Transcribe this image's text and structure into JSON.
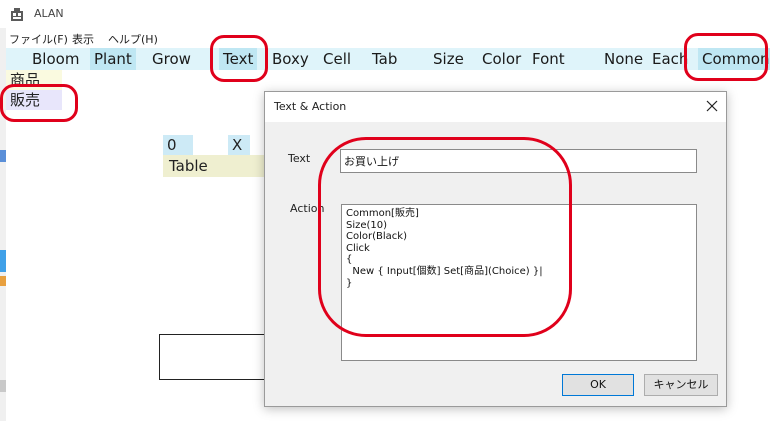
{
  "window": {
    "title": "ALAN"
  },
  "menu": [
    {
      "label": "ファイル(F)"
    },
    {
      "label": "表示"
    },
    {
      "label": "ヘルプ(H)"
    }
  ],
  "toolbar": {
    "items": [
      {
        "label": "Bloom"
      },
      {
        "label": "Plant",
        "highlighted": true
      },
      {
        "label": "Grow"
      },
      {
        "label": "Text",
        "highlighted": true,
        "annotated": true
      },
      {
        "label": "Boxy"
      },
      {
        "label": "Cell"
      },
      {
        "label": "Tab"
      },
      {
        "label": "Size"
      },
      {
        "label": "Color"
      },
      {
        "label": "Font"
      },
      {
        "label": "None"
      },
      {
        "label": "Each"
      },
      {
        "label": "Common",
        "highlighted": true,
        "annotated": true
      }
    ]
  },
  "list": {
    "items": [
      {
        "label": "商品"
      },
      {
        "label": "販売",
        "selected": true,
        "annotated": true
      }
    ]
  },
  "canvas": {
    "cell_zero": "0",
    "cell_x": "X",
    "table_label": "Table"
  },
  "dialog": {
    "title": "Text & Action",
    "text_label": "Text",
    "text_value": "お買い上げ",
    "action_label": "Action",
    "action_value": "Common[販売]\nSize(10)\nColor(Black)\nClick\n{\n  New { Input[個数] Set[商品](Choice) }|\n}",
    "ok_label": "OK",
    "cancel_label": "キャンセル"
  },
  "colors": {
    "annotation": "#e0001b",
    "toolbar_bg": "#dff4fa",
    "toolbar_highlight": "#bfe7f3"
  }
}
